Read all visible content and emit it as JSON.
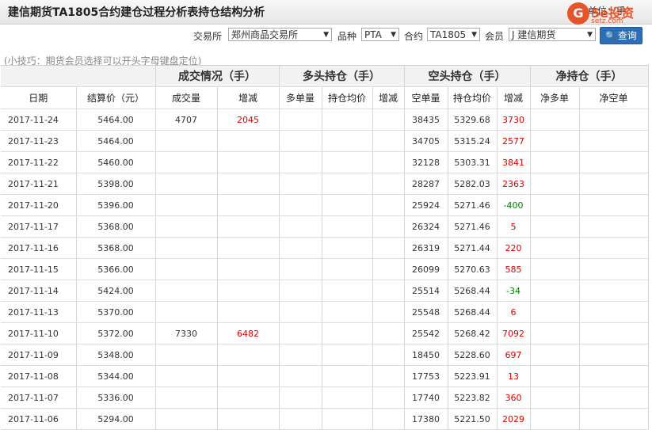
{
  "title": "建信期货TA1805合约建仓过程分析表持仓结构分析",
  "unit_label": "单位：手",
  "logo": {
    "main": "5e投资",
    "sub": "setz.com",
    "glyph": "G"
  },
  "filters": {
    "exchange_label": "交易所",
    "exchange_value": "郑州商品交易所",
    "product_label": "品种",
    "product_value": "PTA",
    "contract_label": "合约",
    "contract_value": "TA1805",
    "member_label": "会员",
    "member_value": "J 建信期货",
    "query_label": "查询"
  },
  "tip": "(小技巧：期货会员选择可以开头字母键盘定位)",
  "groups": [
    "成交情况（手）",
    "多头持仓（手）",
    "空头持仓（手）",
    "净持仓（手）"
  ],
  "columns": [
    "日期",
    "结算价（元）",
    "成交量",
    "增减",
    "多单量",
    "持仓均价",
    "增减",
    "空单量",
    "持仓均价",
    "增减",
    "净多单",
    "净空单"
  ],
  "rows": [
    {
      "date": "2017-11-24",
      "price": "5464.00",
      "vol": "4707",
      "vol_chg": "2045",
      "vol_dir": "up",
      "short": "38435",
      "short_avg": "5329.68",
      "short_chg": "3730",
      "short_dir": "up"
    },
    {
      "date": "2017-11-23",
      "price": "5464.00",
      "vol": "",
      "vol_chg": "",
      "vol_dir": "",
      "short": "34705",
      "short_avg": "5315.24",
      "short_chg": "2577",
      "short_dir": "up"
    },
    {
      "date": "2017-11-22",
      "price": "5460.00",
      "vol": "",
      "vol_chg": "",
      "vol_dir": "",
      "short": "32128",
      "short_avg": "5303.31",
      "short_chg": "3841",
      "short_dir": "up"
    },
    {
      "date": "2017-11-21",
      "price": "5398.00",
      "vol": "",
      "vol_chg": "",
      "vol_dir": "",
      "short": "28287",
      "short_avg": "5282.03",
      "short_chg": "2363",
      "short_dir": "up"
    },
    {
      "date": "2017-11-20",
      "price": "5396.00",
      "vol": "",
      "vol_chg": "",
      "vol_dir": "",
      "short": "25924",
      "short_avg": "5271.46",
      "short_chg": "-400",
      "short_dir": "down"
    },
    {
      "date": "2017-11-17",
      "price": "5368.00",
      "vol": "",
      "vol_chg": "",
      "vol_dir": "",
      "short": "26324",
      "short_avg": "5271.46",
      "short_chg": "5",
      "short_dir": "up"
    },
    {
      "date": "2017-11-16",
      "price": "5368.00",
      "vol": "",
      "vol_chg": "",
      "vol_dir": "",
      "short": "26319",
      "short_avg": "5271.44",
      "short_chg": "220",
      "short_dir": "up"
    },
    {
      "date": "2017-11-15",
      "price": "5366.00",
      "vol": "",
      "vol_chg": "",
      "vol_dir": "",
      "short": "26099",
      "short_avg": "5270.63",
      "short_chg": "585",
      "short_dir": "up"
    },
    {
      "date": "2017-11-14",
      "price": "5424.00",
      "vol": "",
      "vol_chg": "",
      "vol_dir": "",
      "short": "25514",
      "short_avg": "5268.44",
      "short_chg": "-34",
      "short_dir": "down"
    },
    {
      "date": "2017-11-13",
      "price": "5370.00",
      "vol": "",
      "vol_chg": "",
      "vol_dir": "",
      "short": "25548",
      "short_avg": "5268.44",
      "short_chg": "6",
      "short_dir": "up"
    },
    {
      "date": "2017-11-10",
      "price": "5372.00",
      "vol": "7330",
      "vol_chg": "6482",
      "vol_dir": "up",
      "short": "25542",
      "short_avg": "5268.42",
      "short_chg": "7092",
      "short_dir": "up"
    },
    {
      "date": "2017-11-09",
      "price": "5348.00",
      "vol": "",
      "vol_chg": "",
      "vol_dir": "",
      "short": "18450",
      "short_avg": "5228.60",
      "short_chg": "697",
      "short_dir": "up"
    },
    {
      "date": "2017-11-08",
      "price": "5344.00",
      "vol": "",
      "vol_chg": "",
      "vol_dir": "",
      "short": "17753",
      "short_avg": "5223.91",
      "short_chg": "13",
      "short_dir": "up"
    },
    {
      "date": "2017-11-07",
      "price": "5336.00",
      "vol": "",
      "vol_chg": "",
      "vol_dir": "",
      "short": "17740",
      "short_avg": "5223.82",
      "short_chg": "360",
      "short_dir": "up"
    },
    {
      "date": "2017-11-06",
      "price": "5294.00",
      "vol": "",
      "vol_chg": "",
      "vol_dir": "",
      "short": "17380",
      "short_avg": "5221.50",
      "short_chg": "2029",
      "short_dir": "up"
    }
  ]
}
